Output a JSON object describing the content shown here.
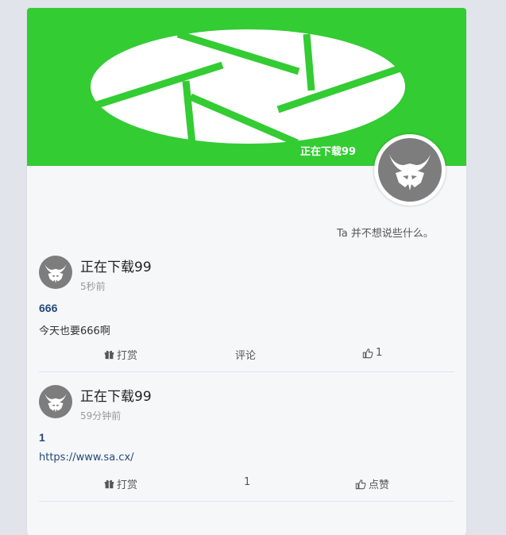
{
  "profile": {
    "name": "正在下载99",
    "bio": "Ta 并不想说些什么。",
    "banner_color": "#33cc33"
  },
  "posts": [
    {
      "author": "正在下载99",
      "time": "5秒前",
      "title": "666",
      "content": "今天也要666啊",
      "content_is_link": false,
      "reward_label": "打赏",
      "comment_label": "评论",
      "like_label": "1"
    },
    {
      "author": "正在下载99",
      "time": "59分钟前",
      "title": "1",
      "content": "https://www.sa.cx/",
      "content_is_link": true,
      "reward_label": "打赏",
      "comment_label": "1",
      "like_label": "点赞"
    }
  ],
  "icons": {
    "reward": "gift-icon",
    "like": "thumbs-up-icon",
    "avatar": "horned-mask-icon",
    "banner": "camera-aperture-icon"
  }
}
